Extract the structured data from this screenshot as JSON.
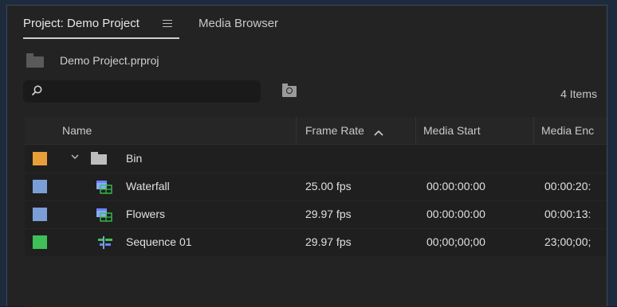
{
  "tabs": [
    {
      "label": "Project: Demo Project"
    },
    {
      "label": "Media Browser"
    }
  ],
  "project": {
    "file_name": "Demo Project.prproj"
  },
  "search": {
    "placeholder": ""
  },
  "items_count": "4 Items",
  "columns": {
    "name": "Name",
    "frame_rate": "Frame Rate",
    "media_start": "Media Start",
    "media_end": "Media Enc"
  },
  "rows": [
    {
      "color": "#e89f3a",
      "name": "Bin",
      "frame_rate": "",
      "media_start": "",
      "media_end": ""
    },
    {
      "color": "#7a9fd6",
      "name": "Waterfall",
      "frame_rate": "25.00 fps",
      "media_start": "00:00:00:00",
      "media_end": "00:00:20:"
    },
    {
      "color": "#7a9fd6",
      "name": "Flowers",
      "frame_rate": "29.97 fps",
      "media_start": "00:00:00:00",
      "media_end": "00:00:13:"
    },
    {
      "color": "#3fbf57",
      "name": "Sequence 01",
      "frame_rate": "29.97 fps",
      "media_start": "00;00;00;00",
      "media_end": "23;00;00;"
    }
  ]
}
